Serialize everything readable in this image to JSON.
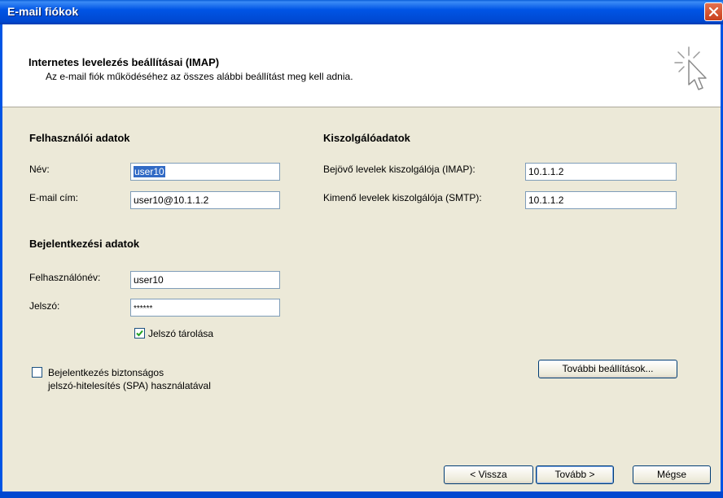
{
  "window": {
    "title": "E-mail fiókok"
  },
  "header": {
    "title": "Internetes levelezés beállításai (IMAP)",
    "subtitle": "Az e-mail fiók működéséhez az összes alábbi beállítást meg kell adnia."
  },
  "user_section": {
    "title": "Felhasználói adatok",
    "name_label": "Név:",
    "name_value": "user10",
    "email_label": "E-mail cím:",
    "email_value": "user10@10.1.1.2"
  },
  "server_section": {
    "title": "Kiszolgálóadatok",
    "incoming_label": "Bejövő levelek kiszolgálója (IMAP):",
    "incoming_value": "10.1.1.2",
    "outgoing_label": "Kimenő levelek kiszolgálója (SMTP):",
    "outgoing_value": "10.1.1.2"
  },
  "login_section": {
    "title": "Bejelentkezési adatok",
    "username_label": "Felhasználónév:",
    "username_value": "user10",
    "password_label": "Jelszó:",
    "password_value": "******",
    "remember_label": "Jelszó tárolása",
    "remember_checked": true
  },
  "spa": {
    "line1": "Bejelentkezés biztonságos",
    "line2": "jelszó-hitelesítés (SPA) használatával",
    "checked": false
  },
  "buttons": {
    "more_settings": "További beállítások...",
    "back": "< Vissza",
    "next": "Tovább >",
    "cancel": "Mégse"
  },
  "colors": {
    "titlebar": "#0055e5",
    "close": "#c9401d",
    "selection": "#316ac5"
  }
}
